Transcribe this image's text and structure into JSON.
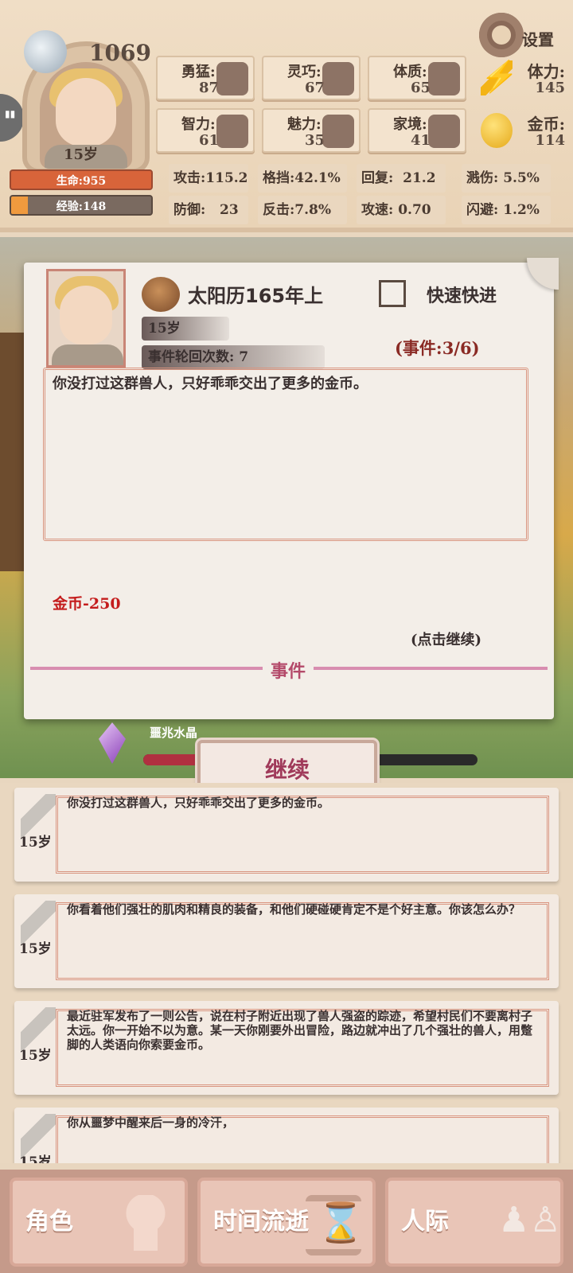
{
  "player": {
    "score": "1069",
    "age": "15岁",
    "hp_label": "生命:955",
    "xp_label": "经验:148",
    "xp_progress": 0.12
  },
  "settings_label": "设置",
  "attributes": [
    {
      "label": "勇猛:",
      "value": "87"
    },
    {
      "label": "灵巧:",
      "value": "67"
    },
    {
      "label": "体质:",
      "value": "65"
    },
    {
      "label": "智力:",
      "value": "61"
    },
    {
      "label": "魅力:",
      "value": "35"
    },
    {
      "label": "家境:",
      "value": "41"
    }
  ],
  "resources": {
    "stamina": {
      "label": "体力:",
      "value": "145"
    },
    "gold": {
      "label": "金币:",
      "value": "114"
    }
  },
  "combat_stats": [
    {
      "label": "攻击:",
      "value": "115.2"
    },
    {
      "label": "格挡:",
      "value": "42.1%"
    },
    {
      "label": "回复:",
      "value": "21.2"
    },
    {
      "label": "溅伤:",
      "value": "5.5%"
    },
    {
      "label": "防御:",
      "value": "23"
    },
    {
      "label": "反击:",
      "value": "7.8%"
    },
    {
      "label": "攻速:",
      "value": "0.70"
    },
    {
      "label": "闪避:",
      "value": "1.2%"
    }
  ],
  "event": {
    "date": "太阳历165年上",
    "fast_forward": "快速快进",
    "age": "15岁",
    "cycle_label": "事件轮回次数:",
    "cycle_value": "7",
    "count": "(事件:3/6)",
    "text": "你没打过这群兽人，只好乖乖交出了更多的金币。",
    "result": "金币-250",
    "tap_hint": "(点击继续)",
    "footer": "事件"
  },
  "crystal": {
    "label": "噩兆水晶",
    "progress": 0.16
  },
  "continue_label": "继续",
  "log": [
    {
      "age": "15岁",
      "text": "你没打过这群兽人，只好乖乖交出了更多的金币。"
    },
    {
      "age": "15岁",
      "text": "你看着他们强壮的肌肉和精良的装备，和他们硬碰硬肯定不是个好主意。你该怎么办？"
    },
    {
      "age": "15岁",
      "text": "最近驻军发布了一则公告，说在村子附近出现了兽人强盗的踪迹，希望村民们不要离村子太远。你一开始不以为意。某一天你刚要外出冒险，路边就冲出了几个强壮的兽人，用蹩脚的人类语向你索要金币。"
    },
    {
      "age": "15岁",
      "text": "你从噩梦中醒来后一身的冷汗，"
    }
  ],
  "nav": [
    {
      "label": "角色",
      "icon": "character-icon"
    },
    {
      "label": "时间流逝",
      "icon": "hourglass-icon"
    },
    {
      "label": "人际",
      "icon": "people-icon"
    }
  ],
  "colors": {
    "hp": "#d8643a",
    "xp": "#f09a3e",
    "gold_loss": "#c41c1c",
    "accent": "#b44a6a"
  }
}
